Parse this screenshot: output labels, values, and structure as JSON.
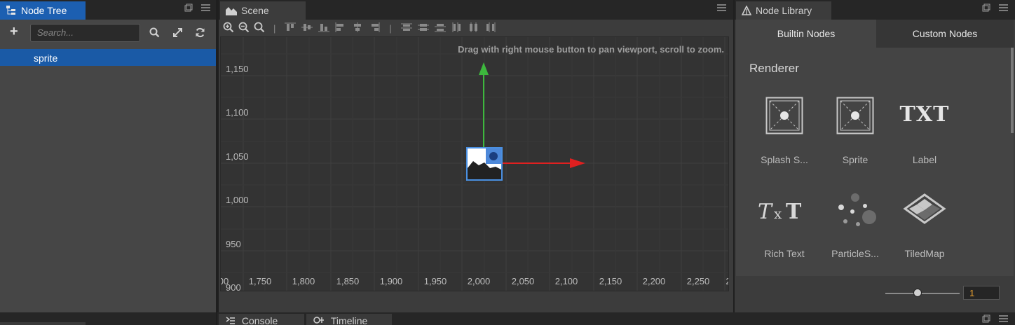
{
  "node_tree": {
    "tab_label": "Node Tree",
    "add_label": "+",
    "search_placeholder": "Search...",
    "rows": [
      {
        "label": "sprite"
      }
    ]
  },
  "scene": {
    "tab_label": "Scene",
    "hint": "Drag with right mouse button to pan viewport, scroll to zoom.",
    "y_ticks": [
      "1,150",
      "1,100",
      "1,050",
      "1,000",
      "950",
      "900"
    ],
    "x_ticks": [
      "00",
      "1,750",
      "1,800",
      "1,850",
      "1,900",
      "1,950",
      "2,000",
      "2,050",
      "2,100",
      "2,150",
      "2,200",
      "2,250",
      "2"
    ]
  },
  "library": {
    "tab_label": "Node Library",
    "tabs": [
      "Builtin Nodes",
      "Custom Nodes"
    ],
    "section": "Renderer",
    "items": [
      {
        "label": "Splash S...",
        "icon": "splash-sprite-icon"
      },
      {
        "label": "Sprite",
        "icon": "sprite-icon"
      },
      {
        "label": "Label",
        "icon": "label-icon",
        "glyph": "TXT"
      },
      {
        "label": "Rich Text",
        "icon": "rich-text-icon"
      },
      {
        "label": "ParticleS...",
        "icon": "particle-system-icon"
      },
      {
        "label": "TiledMap",
        "icon": "tiledmap-icon"
      }
    ],
    "zoom_value": "1"
  },
  "bottom": {
    "tabs": [
      "Console",
      "Timeline"
    ]
  },
  "colors": {
    "accent": "#1c5fb1",
    "gizmo_x": "#e02020",
    "gizmo_y": "#3db83d"
  }
}
